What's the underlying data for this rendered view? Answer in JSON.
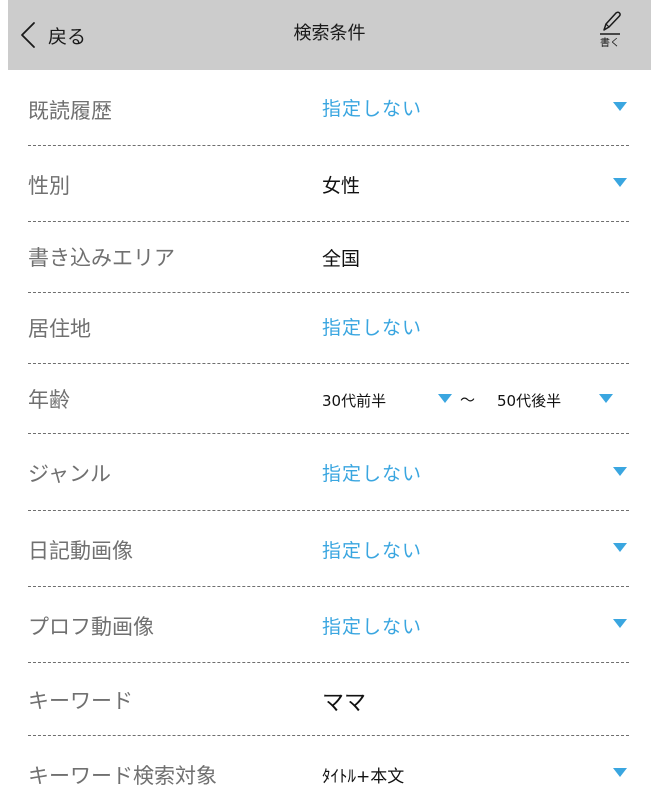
{
  "header": {
    "back_label": "戻る",
    "title": "検索条件",
    "write_label": "書く",
    "icons": {
      "back": "chevron-left-icon",
      "write": "pen-icon"
    }
  },
  "rows": [
    {
      "label": "既読履歴",
      "value": "指定しない",
      "value_style": "blue",
      "dropdown": true
    },
    {
      "label": "性別",
      "value": "女性",
      "value_style": "dark",
      "dropdown": true
    },
    {
      "label": "書き込みエリア",
      "value": "全国",
      "value_style": "dark",
      "dropdown": false
    },
    {
      "label": "居住地",
      "value": "指定しない",
      "value_style": "blue",
      "dropdown": false
    },
    {
      "label": "年齢",
      "value_from": "30代前半",
      "separator": "〜",
      "value_to": "50代後半",
      "dropdown": true
    },
    {
      "label": "ジャンル",
      "value": "指定しない",
      "value_style": "blue",
      "dropdown": true
    },
    {
      "label": "日記動画像",
      "value": "指定しない",
      "value_style": "blue",
      "dropdown": true
    },
    {
      "label": "プロフ動画像",
      "value": "指定しない",
      "value_style": "blue",
      "dropdown": true
    },
    {
      "label": "キーワード",
      "value": "ママ",
      "value_style": "dark",
      "dropdown": false
    },
    {
      "label": "キーワード検索対象",
      "value": "ﾀｲﾄﾙ+本文",
      "value_style": "dark",
      "dropdown": true
    }
  ],
  "colors": {
    "header_bg": "#cccccc",
    "accent_blue": "#3aa6e0",
    "label_gray": "#707070",
    "divider": "#6f6f6f"
  }
}
